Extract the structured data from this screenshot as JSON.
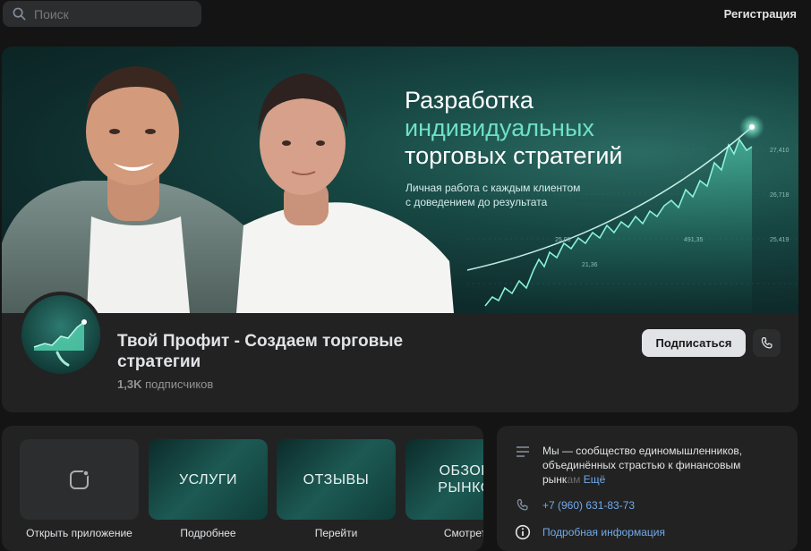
{
  "search": {
    "placeholder": "Поиск"
  },
  "header": {
    "register_label": "Регистрация"
  },
  "cover": {
    "title_line1": "Разработка",
    "title_line2": "индивидуальных",
    "title_line3": "торговых стратегий",
    "subtitle_line1": "Личная работа с каждым клиентом",
    "subtitle_line2": "с доведением до результата",
    "chart_labels": [
      "27,410",
      "26,718",
      "25,419",
      "25,00",
      "491,35",
      "21,36"
    ]
  },
  "profile": {
    "name": "Твой Профит - Создаем торговые стратегии",
    "subscribers_count": "1,3K",
    "subscribers_label": "подписчиков",
    "subscribe_label": "Подписаться"
  },
  "apps": [
    {
      "label": "Открыть приложение"
    },
    {
      "label": "Подробнее",
      "image_text": "УСЛУГИ"
    },
    {
      "label": "Перейти",
      "image_text": "ОТЗЫВЫ"
    },
    {
      "label": "Смотрет",
      "image_text": "ОБЗОР РЫНКО"
    }
  ],
  "about": {
    "description": "Мы — сообщество единомышленников, объединённых страстью к финансовым рынкам",
    "desc_visible": "Мы — сообщество единомышленников, объединённых страстью к финансовым рынк",
    "desc_fade": "ам",
    "more_label": "Ещё",
    "phone": "+7 (960) 631-83-73",
    "details_label": "Подробная информация"
  },
  "colors": {
    "accent": "#6fe0c4",
    "link": "#71aaeb",
    "background": "#141414",
    "card": "#222222"
  }
}
